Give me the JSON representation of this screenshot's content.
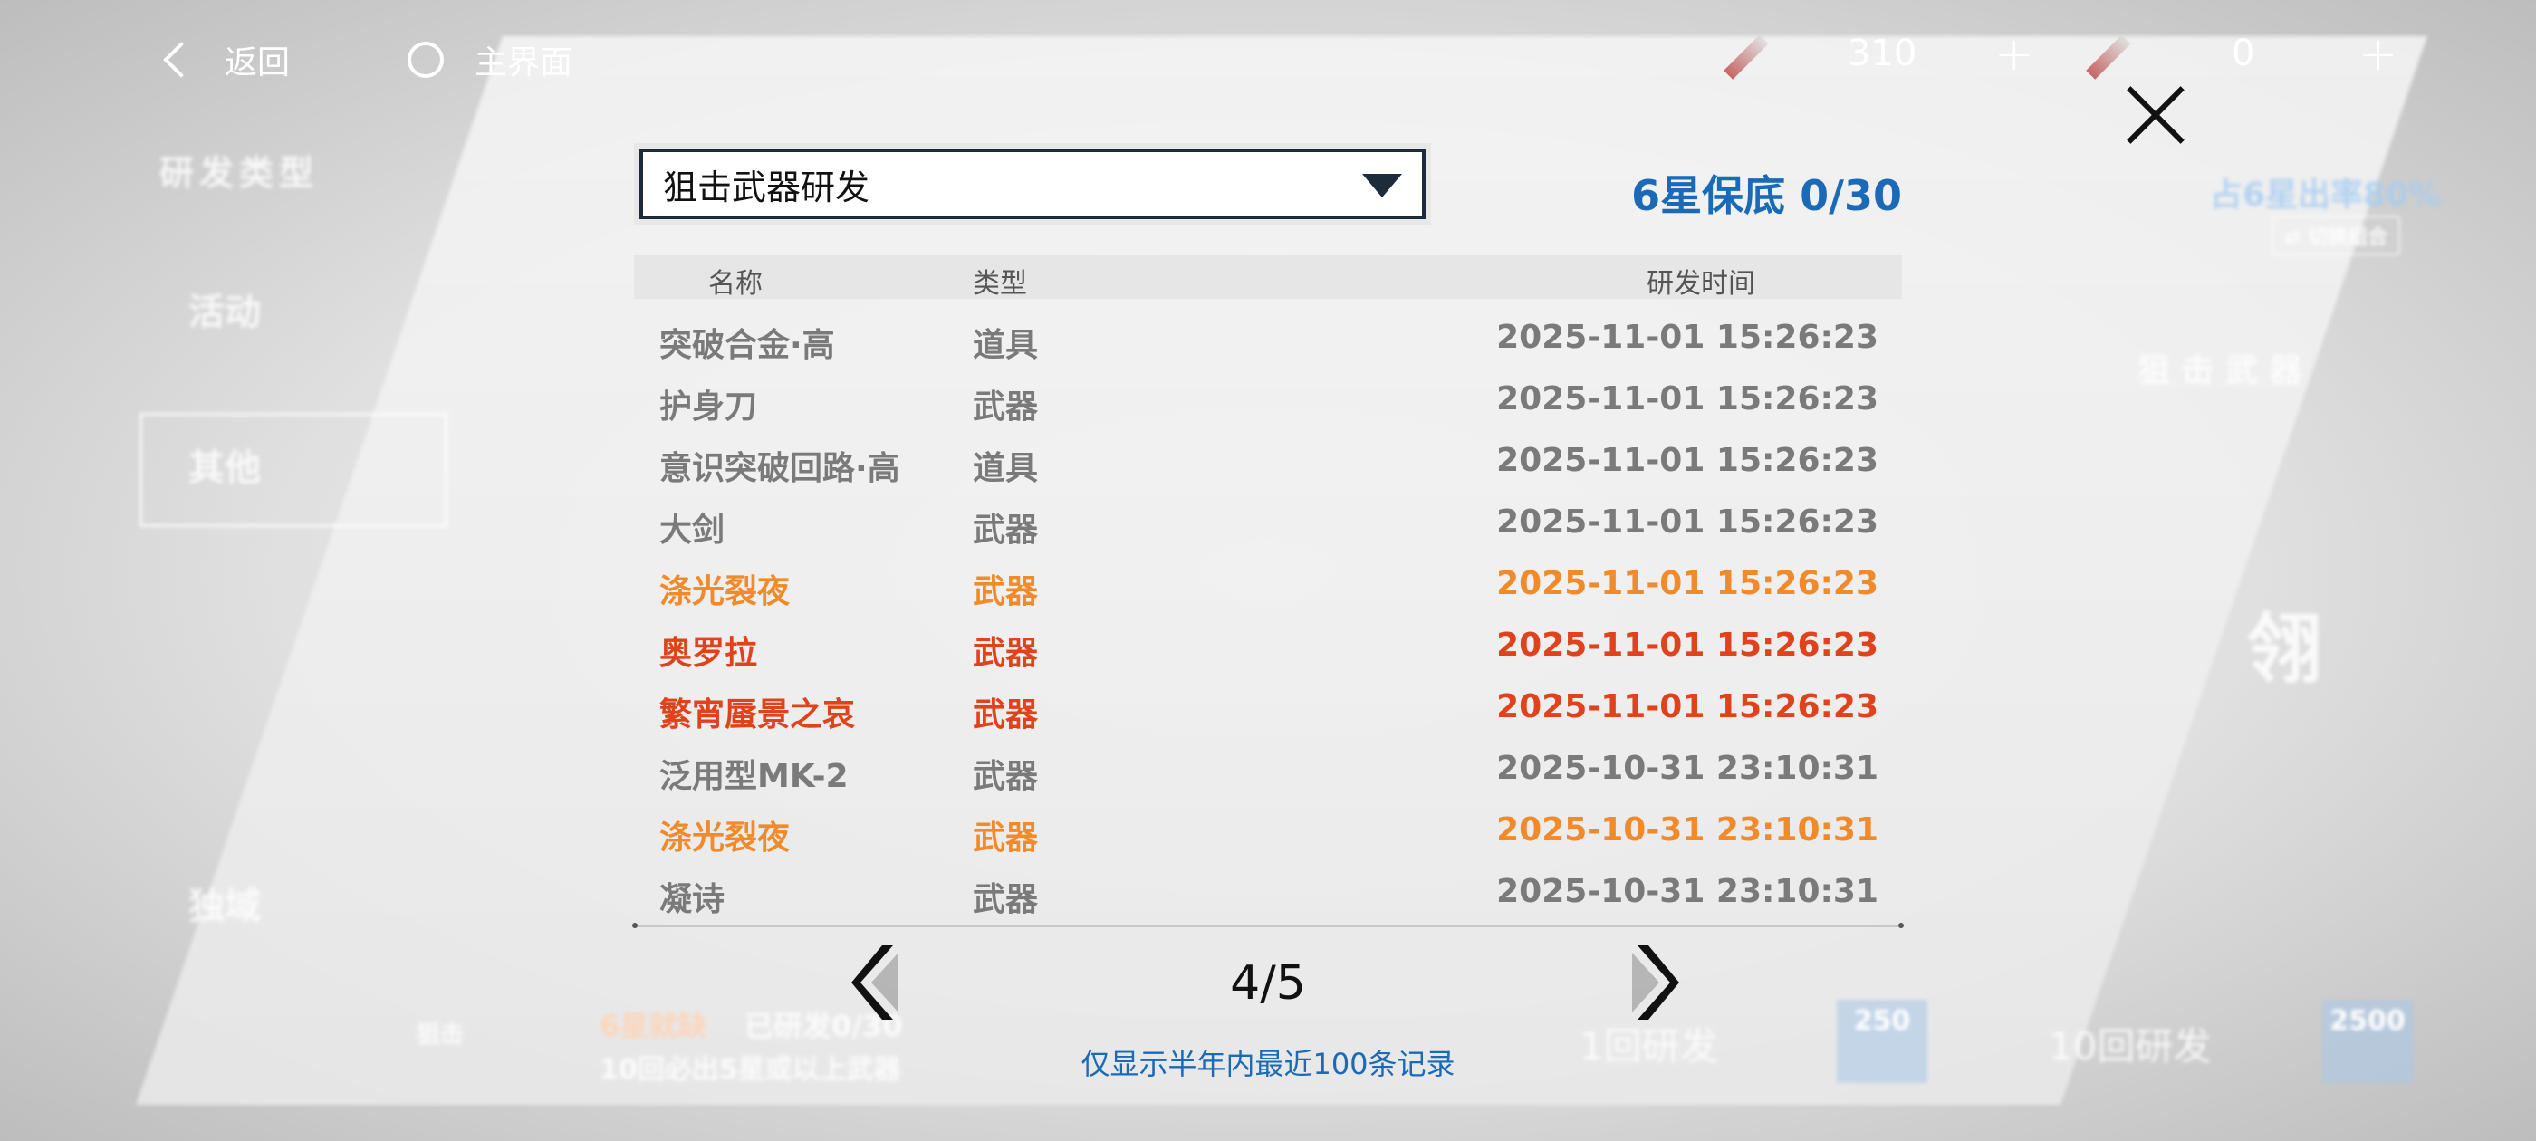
{
  "topbar": {
    "back_label": "返回",
    "home_label": "主界面",
    "resource1_value": "310",
    "resource2_value": "0",
    "plus": "+"
  },
  "background": {
    "category_title": "研发类型",
    "tab_activity": "活动",
    "tab_other": "其他",
    "tab_exclusive": "独域",
    "rate_text": "占6星出率80%",
    "switch_label": "切换组合",
    "weapon_banner": "狙 击 武 器",
    "banner_big_char": "翎",
    "pity_hint_a": "6星就缺",
    "pity_hint_b": "已研发0/30",
    "pity_hint_c": "10回必出5星或以上武器",
    "single_pull": "1回研发",
    "single_cost": "250",
    "ten_pull": "10回研发",
    "ten_cost": "2500",
    "small_label": "狙击"
  },
  "panel": {
    "dropdown_value": "狙击武器研发",
    "pity_counter": "6星保底 0/30",
    "columns": {
      "name": "名称",
      "type": "类型",
      "time": "研发时间"
    },
    "rows": [
      {
        "name": "突破合金·高",
        "type": "道具",
        "time": "2025-11-01 15:26:23",
        "rarity": "normal"
      },
      {
        "name": "护身刀",
        "type": "武器",
        "time": "2025-11-01 15:26:23",
        "rarity": "normal"
      },
      {
        "name": "意识突破回路·高",
        "type": "道具",
        "time": "2025-11-01 15:26:23",
        "rarity": "normal"
      },
      {
        "name": "大剑",
        "type": "武器",
        "time": "2025-11-01 15:26:23",
        "rarity": "normal"
      },
      {
        "name": "涤光裂夜",
        "type": "武器",
        "time": "2025-11-01 15:26:23",
        "rarity": "5star"
      },
      {
        "name": "奥罗拉",
        "type": "武器",
        "time": "2025-11-01 15:26:23",
        "rarity": "6star"
      },
      {
        "name": "繁宵蜃景之哀",
        "type": "武器",
        "time": "2025-11-01 15:26:23",
        "rarity": "6star"
      },
      {
        "name": "泛用型MK-2",
        "type": "武器",
        "time": "2025-10-31 23:10:31",
        "rarity": "normal"
      },
      {
        "name": "涤光裂夜",
        "type": "武器",
        "time": "2025-10-31 23:10:31",
        "rarity": "5star"
      },
      {
        "name": "凝诗",
        "type": "武器",
        "time": "2025-10-31 23:10:31",
        "rarity": "normal"
      }
    ],
    "page_indicator": "4/5",
    "footnote": "仅显示半年内最近100条记录"
  },
  "colors": {
    "accent_blue": "#1b6ab8",
    "rarity_5star": "#f08a2a",
    "rarity_6star": "#e0421c",
    "rarity_normal": "#7a7a7a"
  }
}
